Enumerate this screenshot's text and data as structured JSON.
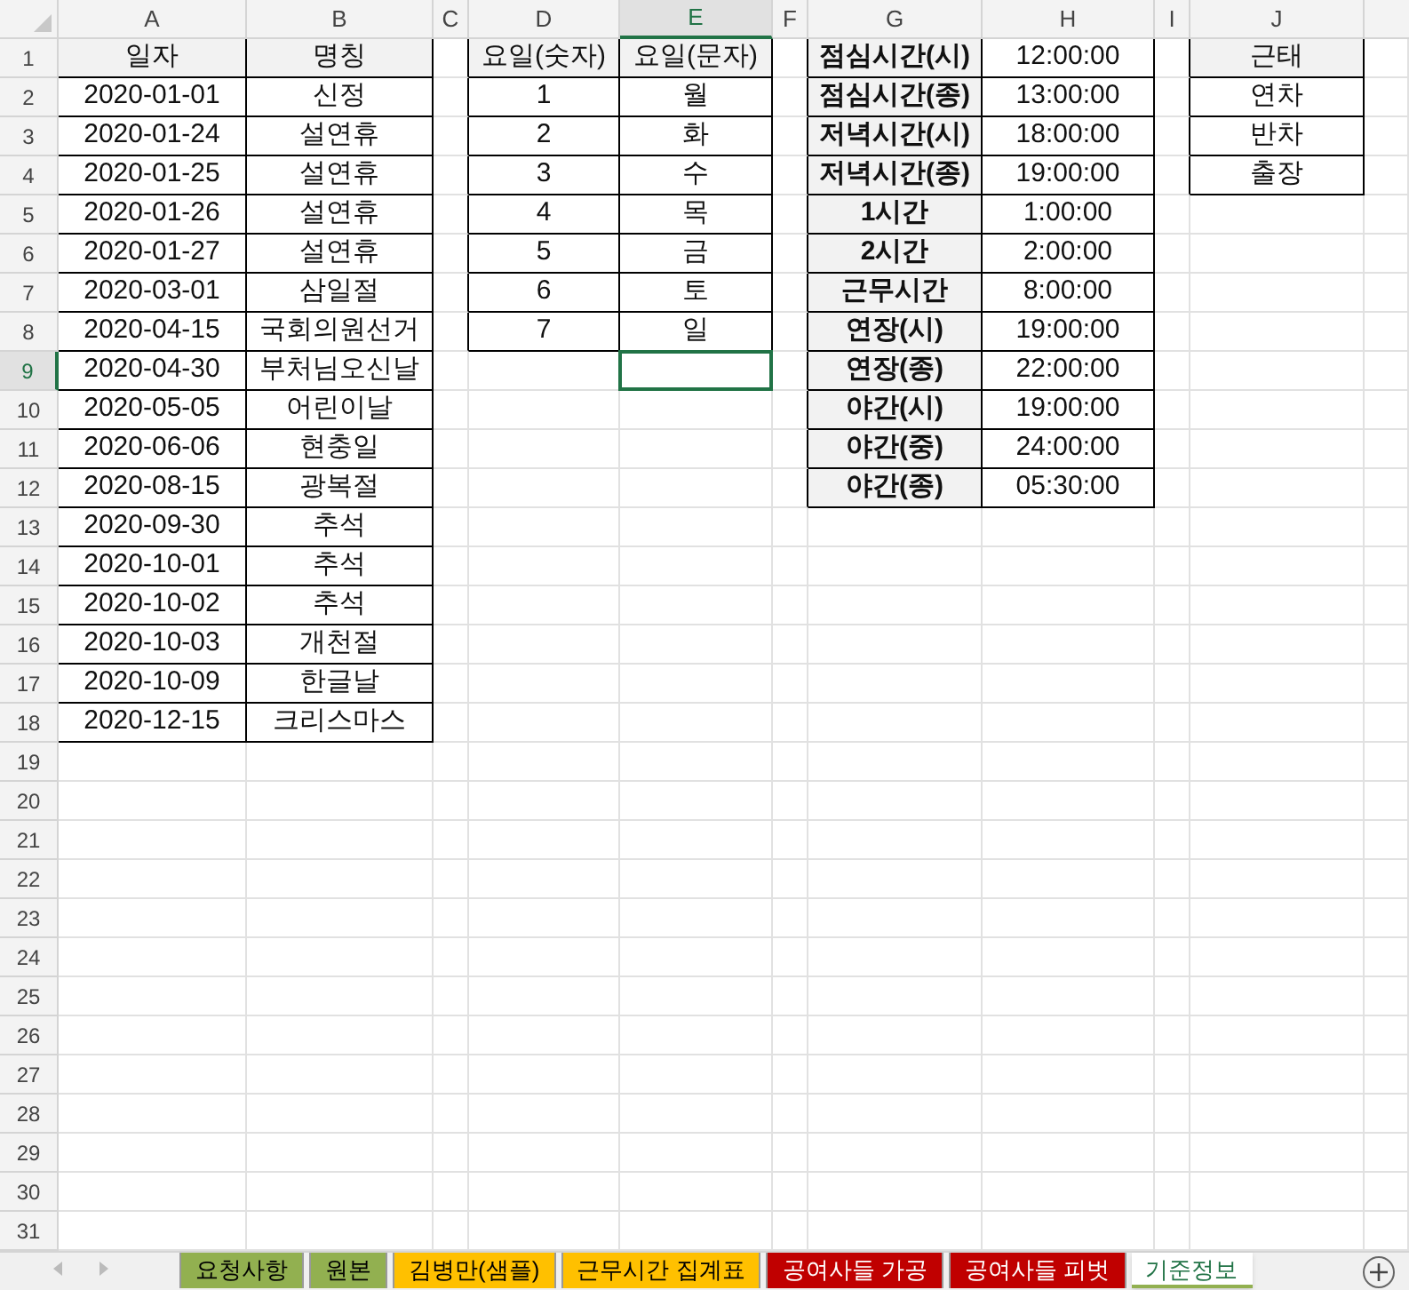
{
  "column_headers": [
    {
      "label": "A",
      "selected": false
    },
    {
      "label": "B",
      "selected": false
    },
    {
      "label": "C",
      "selected": false
    },
    {
      "label": "D",
      "selected": false
    },
    {
      "label": "E",
      "selected": true
    },
    {
      "label": "F",
      "selected": false
    },
    {
      "label": "G",
      "selected": false
    },
    {
      "label": "H",
      "selected": false
    },
    {
      "label": "I",
      "selected": false
    },
    {
      "label": "J",
      "selected": false
    }
  ],
  "row_headers": [
    {
      "label": "1",
      "selected": false
    },
    {
      "label": "2",
      "selected": false
    },
    {
      "label": "3",
      "selected": false
    },
    {
      "label": "4",
      "selected": false
    },
    {
      "label": "5",
      "selected": false
    },
    {
      "label": "6",
      "selected": false
    },
    {
      "label": "7",
      "selected": false
    },
    {
      "label": "8",
      "selected": false
    },
    {
      "label": "9",
      "selected": true
    },
    {
      "label": "10",
      "selected": false
    },
    {
      "label": "11",
      "selected": false
    },
    {
      "label": "12",
      "selected": false
    },
    {
      "label": "13",
      "selected": false
    },
    {
      "label": "14",
      "selected": false
    },
    {
      "label": "15",
      "selected": false
    },
    {
      "label": "16",
      "selected": false
    },
    {
      "label": "17",
      "selected": false
    },
    {
      "label": "18",
      "selected": false
    },
    {
      "label": "19",
      "selected": false
    },
    {
      "label": "20",
      "selected": false
    },
    {
      "label": "21",
      "selected": false
    },
    {
      "label": "22",
      "selected": false
    },
    {
      "label": "23",
      "selected": false
    },
    {
      "label": "24",
      "selected": false
    },
    {
      "label": "25",
      "selected": false
    },
    {
      "label": "26",
      "selected": false
    },
    {
      "label": "27",
      "selected": false
    },
    {
      "label": "28",
      "selected": false
    },
    {
      "label": "29",
      "selected": false
    },
    {
      "label": "30",
      "selected": false
    },
    {
      "label": "31",
      "selected": false
    }
  ],
  "holidays": {
    "columns": [
      "일자",
      "명칭"
    ],
    "rows": [
      [
        "2020-01-01",
        "신정"
      ],
      [
        "2020-01-24",
        "설연휴"
      ],
      [
        "2020-01-25",
        "설연휴"
      ],
      [
        "2020-01-26",
        "설연휴"
      ],
      [
        "2020-01-27",
        "설연휴"
      ],
      [
        "2020-03-01",
        "삼일절"
      ],
      [
        "2020-04-15",
        "국회의원선거"
      ],
      [
        "2020-04-30",
        "부처님오신날"
      ],
      [
        "2020-05-05",
        "어린이날"
      ],
      [
        "2020-06-06",
        "현충일"
      ],
      [
        "2020-08-15",
        "광복절"
      ],
      [
        "2020-09-30",
        "추석"
      ],
      [
        "2020-10-01",
        "추석"
      ],
      [
        "2020-10-02",
        "추석"
      ],
      [
        "2020-10-03",
        "개천절"
      ],
      [
        "2020-10-09",
        "한글날"
      ],
      [
        "2020-12-15",
        "크리스마스"
      ]
    ]
  },
  "weekdays": {
    "columns": [
      "요일(숫자)",
      "요일(문자)"
    ],
    "rows": [
      [
        "1",
        "월"
      ],
      [
        "2",
        "화"
      ],
      [
        "3",
        "수"
      ],
      [
        "4",
        "목"
      ],
      [
        "5",
        "금"
      ],
      [
        "6",
        "토"
      ],
      [
        "7",
        "일"
      ]
    ]
  },
  "times": {
    "rows": [
      [
        "점심시간(시)",
        "12:00:00"
      ],
      [
        "점심시간(종)",
        "13:00:00"
      ],
      [
        "저녁시간(시)",
        "18:00:00"
      ],
      [
        "저녁시간(종)",
        "19:00:00"
      ],
      [
        "1시간",
        "1:00:00"
      ],
      [
        "2시간",
        "2:00:00"
      ],
      [
        "근무시간",
        "8:00:00"
      ],
      [
        "연장(시)",
        "19:00:00"
      ],
      [
        "연장(종)",
        "22:00:00"
      ],
      [
        "야간(시)",
        "19:00:00"
      ],
      [
        "야간(중)",
        "24:00:00"
      ],
      [
        "야간(종)",
        "05:30:00"
      ]
    ]
  },
  "attendance": {
    "columns": [
      "근태"
    ],
    "rows": [
      [
        "연차"
      ],
      [
        "반차"
      ],
      [
        "출장"
      ]
    ]
  },
  "sheet_tabs": [
    {
      "label": "요청사항",
      "color": "#92b050",
      "selected": false
    },
    {
      "label": "원본",
      "color": "#92b050",
      "selected": false
    },
    {
      "label": "김병만(샘플)",
      "color": "#ffc000",
      "selected": false
    },
    {
      "label": "근무시간 집계표",
      "color": "#ffc000",
      "selected": false
    },
    {
      "label": "공여사들 가공",
      "color": "#c00000",
      "selected": false
    },
    {
      "label": "공여사들 피벗",
      "color": "#c00000",
      "selected": false
    },
    {
      "label": "기준정보",
      "color": "#92b050",
      "selected": true
    }
  ]
}
